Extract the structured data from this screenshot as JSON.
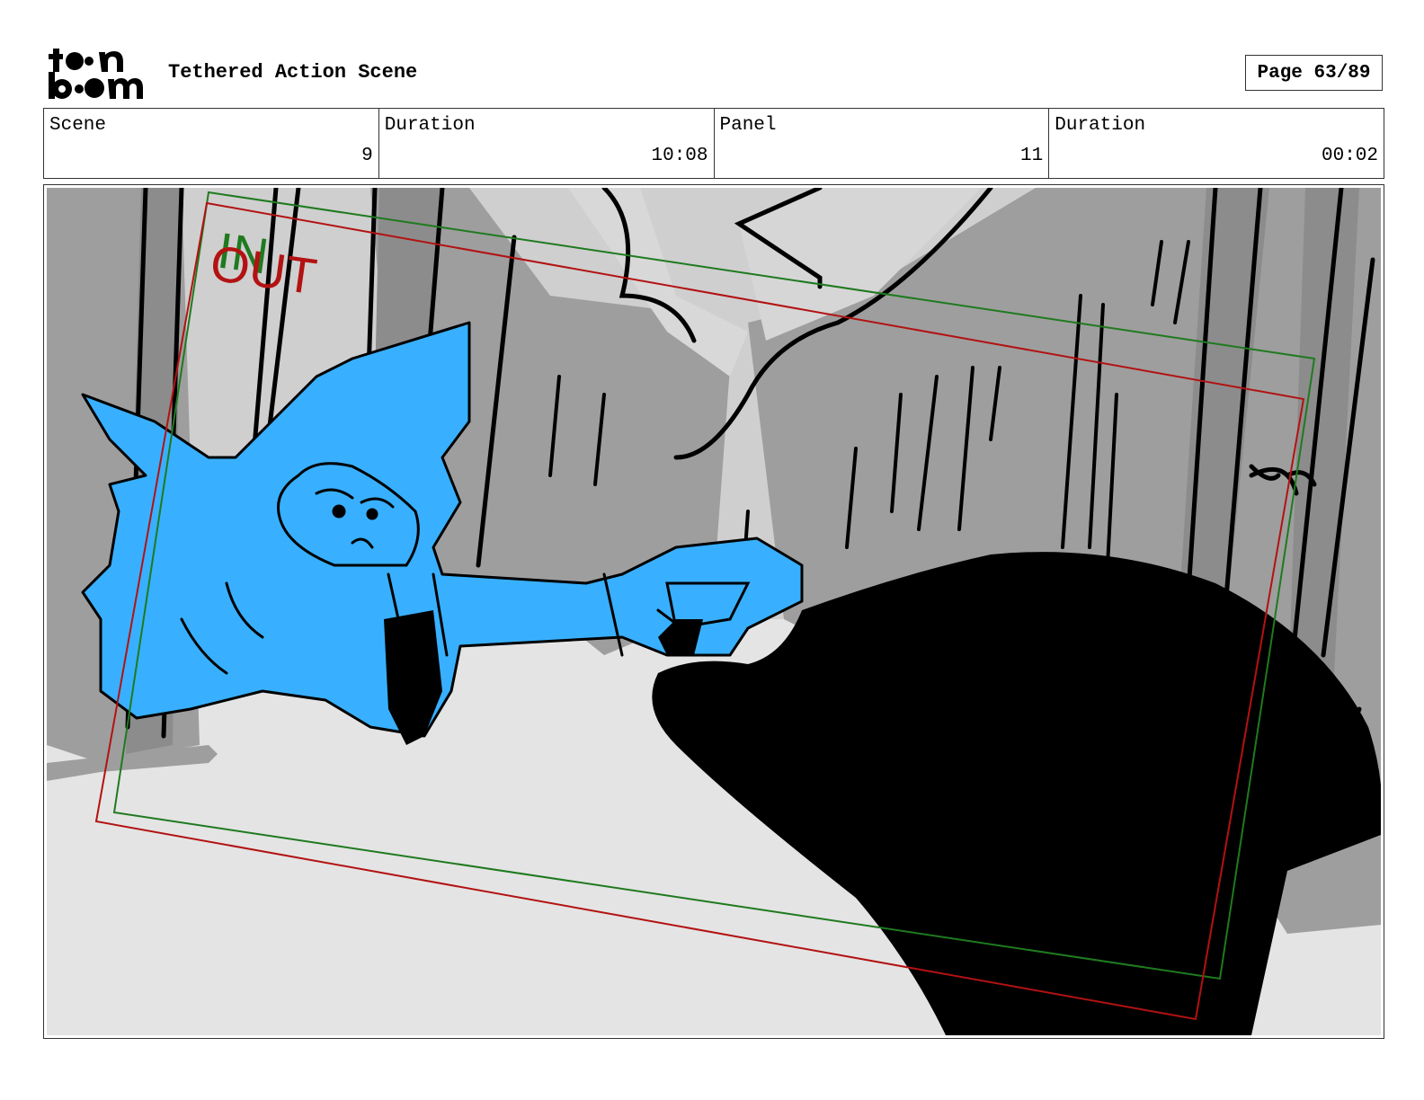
{
  "header": {
    "title": "Tethered Action Scene",
    "page_label": "Page 63/89"
  },
  "info": {
    "scene_label": "Scene",
    "scene_value": "9",
    "scene_duration_label": "Duration",
    "scene_duration_value": "10:08",
    "panel_label": "Panel",
    "panel_value": "11",
    "panel_duration_label": "Duration",
    "panel_duration_value": "00:02"
  },
  "panel": {
    "in_label": "IN",
    "out_label": "OUT",
    "in_color": "#1f7a1f",
    "out_color": "#b31212",
    "character_color": "#38b0ff"
  }
}
